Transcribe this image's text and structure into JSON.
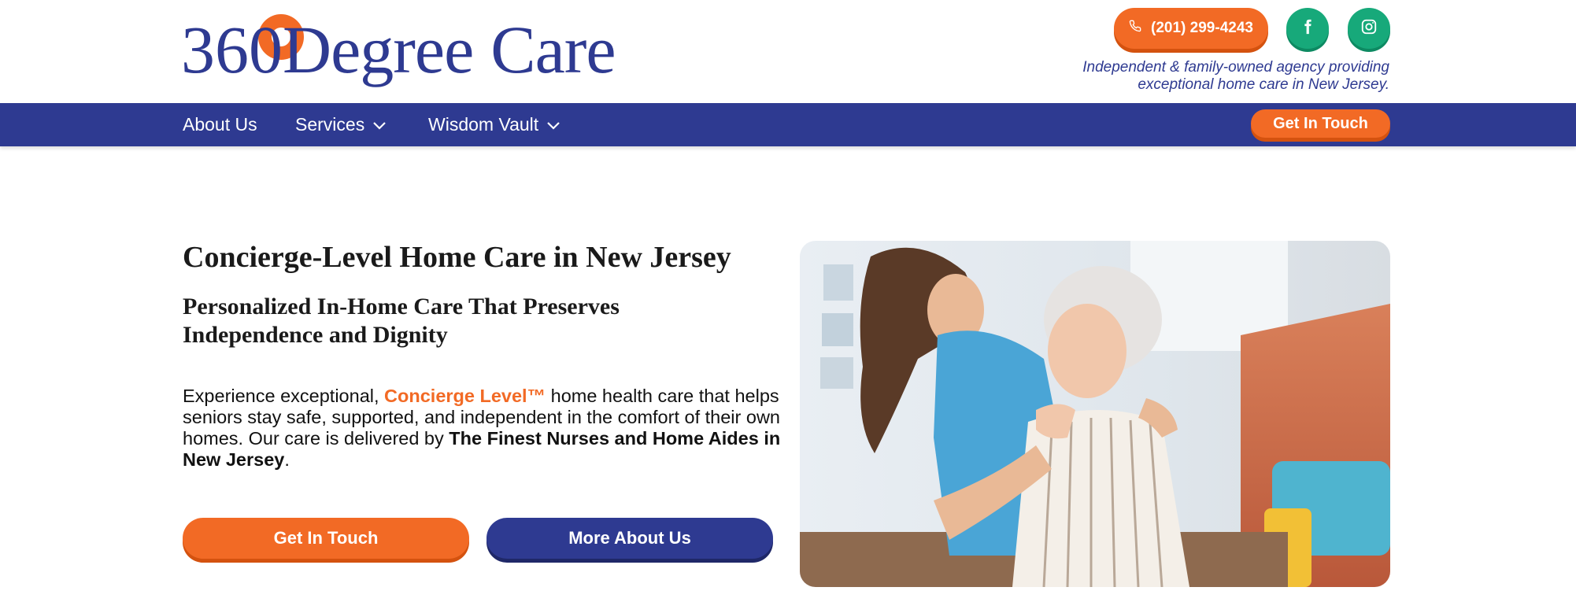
{
  "brand": {
    "logo_num": "36",
    "logo_tail": "0",
    "logo_word1": "Degree",
    "logo_word2": "Care",
    "logo_color": "#2e3a91",
    "accent_color": "#f26a25"
  },
  "header": {
    "phone": "(201) 299-4243",
    "tagline": "Independent & family-owned agency providing exceptional home care in New Jersey.",
    "social": [
      {
        "icon": "facebook-icon"
      },
      {
        "icon": "instagram-icon"
      }
    ]
  },
  "nav": {
    "items": [
      {
        "label": "About Us",
        "has_dropdown": false
      },
      {
        "label": "Services",
        "has_dropdown": true
      },
      {
        "label": "Wisdom Vault",
        "has_dropdown": true
      }
    ],
    "cta": "Get In Touch"
  },
  "hero": {
    "title": "Concierge-Level Home Care in New Jersey",
    "subtitle": "Personalized In-Home Care That Preserves Independence and Dignity",
    "body_1": "Experience exceptional, ",
    "body_accent": "Concierge Level™",
    "body_2": " home health care that helps seniors stay safe, supported, and independent in the comfort of their own homes. Our care is delivered by ",
    "body_strong": "The Finest Nurses and Home Aides in New Jersey",
    "body_3": ".",
    "primary_button": "Get In Touch",
    "secondary_button": "More About Us"
  }
}
